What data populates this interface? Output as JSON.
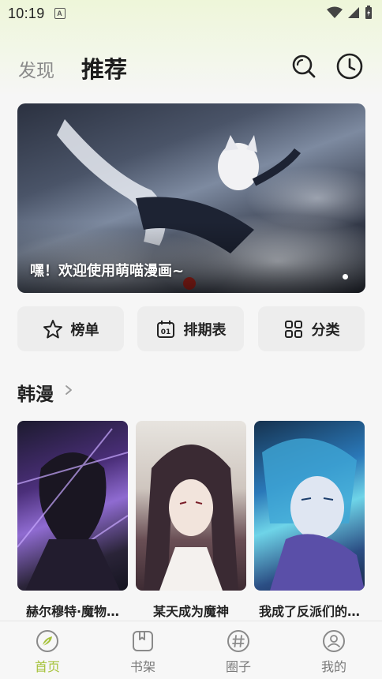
{
  "status_bar": {
    "time": "10:19",
    "notification_icon": "a-letter-icon"
  },
  "header": {
    "tab_discover": "发现",
    "tab_recommend": "推荐"
  },
  "banner": {
    "title": "嘿！欢迎使用萌喵漫画~"
  },
  "quick_actions": [
    {
      "label": "榜单",
      "icon": "ranking-star-icon"
    },
    {
      "label": "排期表",
      "icon": "calendar-icon"
    },
    {
      "label": "分类",
      "icon": "category-grid-icon"
    }
  ],
  "section": {
    "title": "韩漫",
    "cards": [
      {
        "title": "赫尔穆特·魔物…"
      },
      {
        "title": "某天成为魔神"
      },
      {
        "title": "我成了反派们的…"
      }
    ]
  },
  "bottom_nav": [
    {
      "label": "首页",
      "icon": "home-compass-icon",
      "active": true
    },
    {
      "label": "书架",
      "icon": "bookshelf-icon",
      "active": false
    },
    {
      "label": "圈子",
      "icon": "hashtag-icon",
      "active": false
    },
    {
      "label": "我的",
      "icon": "profile-icon",
      "active": false
    }
  ],
  "colors": {
    "accent": "#a6c23a",
    "text": "#222222",
    "muted": "#8a8a8a"
  }
}
